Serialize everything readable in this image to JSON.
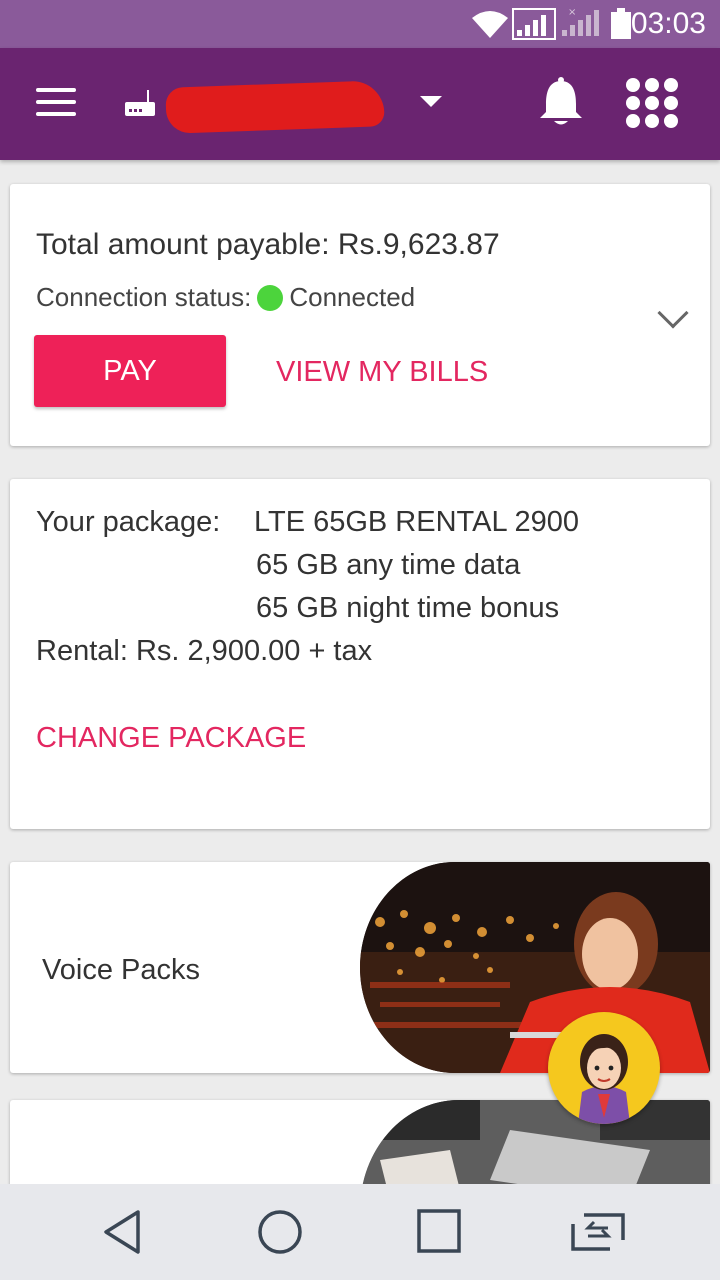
{
  "status_bar": {
    "time": "03:03",
    "background": "#8a5a9a",
    "icons": [
      "wifi-icon",
      "signal-sim1-icon",
      "signal-sim2-icon",
      "battery-icon"
    ]
  },
  "app_bar": {
    "background": "#6a2470",
    "icons": [
      "menu-icon",
      "router-icon",
      "dropdown-icon",
      "bell-icon",
      "apps-grid-icon"
    ],
    "account_name_redacted": true
  },
  "bill_card": {
    "total_label": "Total amount payable: Rs.9,623.87",
    "connection_label": "Connection status:",
    "connection_value": "Connected",
    "connection_color": "#4cd43c",
    "pay_label": "PAY",
    "view_bills_label": "VIEW MY BILLS"
  },
  "package_card": {
    "package_label": "Your package:",
    "package_name": "LTE 65GB RENTAL 2900",
    "features": [
      "65 GB any time data",
      "65 GB night time bonus"
    ],
    "rental": "Rental: Rs. 2,900.00 + tax",
    "change_label": "CHANGE PACKAGE"
  },
  "voice_card": {
    "label": "Voice Packs"
  },
  "theme": {
    "accent": "#ee2158",
    "link": "#e32760"
  },
  "nav_bar": {
    "icons": [
      "back-icon",
      "home-icon",
      "recents-icon",
      "switch-sim-icon"
    ]
  }
}
